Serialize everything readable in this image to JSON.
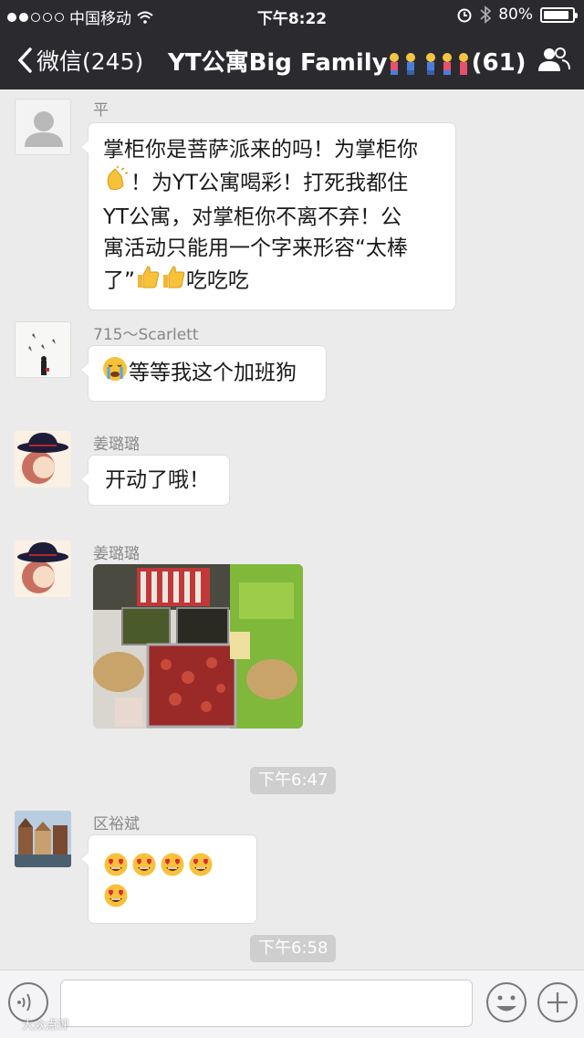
{
  "status_bar": {
    "carrier": "中国移动",
    "time": "下午8:22",
    "battery": "80%",
    "battery_level": 0.8
  },
  "nav": {
    "back_label": "微信(245)",
    "title": "YT公寓Big Family",
    "member_count": "(61)"
  },
  "messages": [
    {
      "sender": "平",
      "text_lines": [
        "掌柜你是菩萨派来的吗！为掌柜你",
        "！为YT公寓喝彩！打死我都住",
        "YT公寓，对掌柜你不离不弃！公",
        "寓活动只能用一个字来形容“太棒",
        "了”",
        "吃吃吃"
      ]
    },
    {
      "sender": "715～Scarlett",
      "text": "等等我这个加班狗"
    },
    {
      "sender": "姜璐璐",
      "text": "开动了哦！"
    },
    {
      "sender": "姜璐璐",
      "image": "food-photo"
    },
    {
      "sender": "区裕斌",
      "emoji_count": 5
    }
  ],
  "timestamps": [
    "下午6:47",
    "下午6:58"
  ],
  "input": {
    "placeholder": ""
  },
  "watermark": "大众点评",
  "colors": {
    "nav_bg": "#2b2b2f",
    "chat_bg": "#ebebeb",
    "bubble_bg": "#ffffff"
  }
}
